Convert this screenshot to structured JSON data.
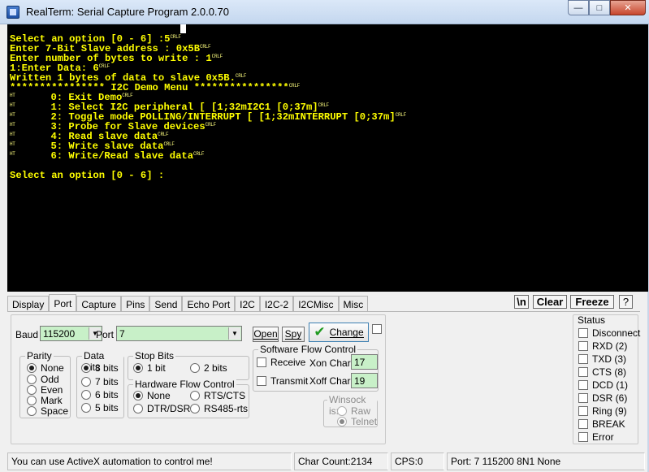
{
  "window": {
    "title": "RealTerm: Serial Capture Program 2.0.0.70",
    "minimize": "—",
    "maximize": "□",
    "close": "✕"
  },
  "terminal": {
    "lines": [
      {
        "text": "",
        "tag": ""
      },
      {
        "text": "Select an option [0 - 6] :5",
        "tag": "CRLF"
      },
      {
        "text": "Enter 7-Bit Slave address : 0x5B",
        "tag": "CRLF"
      },
      {
        "text": "Enter number of bytes to write : 1",
        "tag": "CRLF"
      },
      {
        "text": "1:Enter Data: 6",
        "tag": "CRLF"
      },
      {
        "text": "Written 1 bytes of data to slave 0x5B.",
        "tag": "CRLF"
      },
      {
        "text": "**************** I2C Demo Menu ****************",
        "tag": "CRLF"
      },
      {
        "text": "       0: Exit Demo",
        "tag": "CRLF",
        "prefix": "HT"
      },
      {
        "text": "       1: Select I2C peripheral [ [1;32mI2C1 [0;37m]",
        "tag": "CRLF",
        "prefix": "HT"
      },
      {
        "text": "       2: Toggle mode POLLING/INTERRUPT [ [1;32mINTERRUPT [0;37m]",
        "tag": "CRLF",
        "prefix": "HT"
      },
      {
        "text": "       3: Probe for Slave devices",
        "tag": "CRLF",
        "prefix": "HT"
      },
      {
        "text": "       4: Read slave data",
        "tag": "CRLF",
        "prefix": "HT"
      },
      {
        "text": "       5: Write slave data",
        "tag": "CRLF",
        "prefix": "HT"
      },
      {
        "text": "       6: Write/Read slave data",
        "tag": "CRLF",
        "prefix": "HT"
      },
      {
        "text": "",
        "tag": ""
      },
      {
        "text": "Select an option [0 - 6] :",
        "tag": ""
      }
    ]
  },
  "tabs": [
    "Display",
    "Port",
    "Capture",
    "Pins",
    "Send",
    "Echo Port",
    "I2C",
    "I2C-2",
    "I2CMisc",
    "Misc"
  ],
  "active_tab": "Port",
  "top_buttons": {
    "newline": "\\n",
    "clear": "Clear",
    "freeze": "Freeze",
    "help": "?"
  },
  "port": {
    "baud_label": "Baud",
    "baud_value": "115200",
    "port_label": "Port",
    "port_value": "7",
    "open_label": "Open",
    "spy_label": "Spy",
    "change_label": "Change",
    "parity": {
      "title": "Parity",
      "options": [
        "None",
        "Odd",
        "Even",
        "Mark",
        "Space"
      ],
      "selected": "None"
    },
    "data_bits": {
      "title": "Data Bits",
      "options": [
        "8 bits",
        "7 bits",
        "6 bits",
        "5 bits"
      ],
      "selected": "8 bits"
    },
    "stop_bits": {
      "title": "Stop Bits",
      "options": [
        "1 bit",
        "2 bits"
      ],
      "selected": "1 bit"
    },
    "hw_flow": {
      "title": "Hardware Flow Control",
      "options": [
        "None",
        "RTS/CTS",
        "DTR/DSR",
        "RS485-rts"
      ],
      "selected": "None"
    },
    "sw_flow": {
      "title": "Software Flow Control",
      "receive": "Receive",
      "transmit": "Transmit",
      "xon_label": "Xon Char:",
      "xon_value": "17",
      "xoff_label": "Xoff Char:",
      "xoff_value": "19"
    },
    "winsock": {
      "title": "Winsock is:",
      "options": [
        "Raw",
        "Telnet"
      ],
      "selected": "Telnet"
    }
  },
  "status": {
    "title": "Status",
    "items": [
      "Disconnect",
      "RXD (2)",
      "TXD (3)",
      "CTS (8)",
      "DCD (1)",
      "DSR (6)",
      "Ring (9)",
      "BREAK",
      "Error"
    ]
  },
  "statusbar": {
    "message": "You can use ActiveX automation to control me!",
    "char_count": "Char Count:2134",
    "cps": "CPS:0",
    "port_info": "Port: 7 115200 8N1 None"
  },
  "colors": {
    "terminal_bg": "#000000",
    "terminal_fg": "#ffff00",
    "field_bg": "#c8f0c8"
  }
}
